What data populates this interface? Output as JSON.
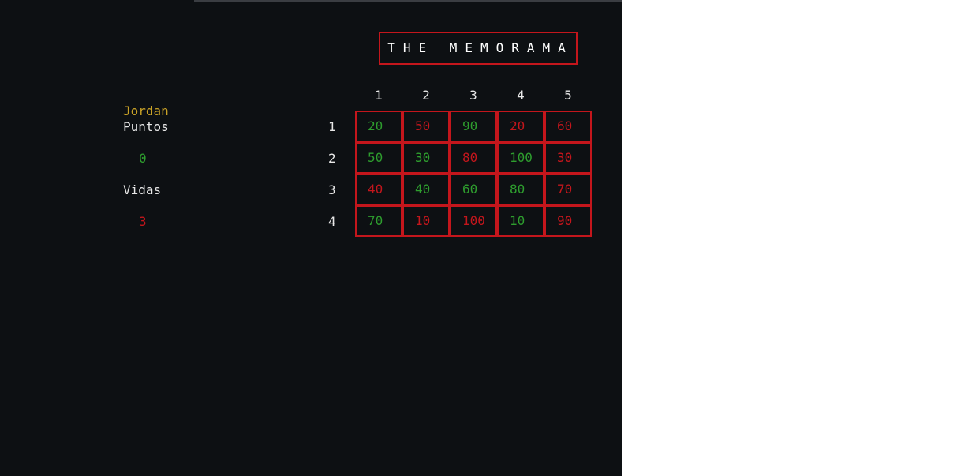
{
  "title": "THE MEMORAMA",
  "player": {
    "name": "Jordan",
    "points_label": "Puntos",
    "points_value": "0",
    "lives_label": "Vidas",
    "lives_value": "3"
  },
  "board": {
    "col_headers": [
      "1",
      "2",
      "3",
      "4",
      "5"
    ],
    "row_headers": [
      "1",
      "2",
      "3",
      "4"
    ],
    "rows": [
      [
        {
          "v": "20",
          "c": "green"
        },
        {
          "v": "50",
          "c": "red"
        },
        {
          "v": "90",
          "c": "green"
        },
        {
          "v": "20",
          "c": "red"
        },
        {
          "v": "60",
          "c": "red"
        }
      ],
      [
        {
          "v": "50",
          "c": "green"
        },
        {
          "v": "30",
          "c": "green"
        },
        {
          "v": "80",
          "c": "red"
        },
        {
          "v": "100",
          "c": "green"
        },
        {
          "v": "30",
          "c": "red"
        }
      ],
      [
        {
          "v": "40",
          "c": "red"
        },
        {
          "v": "40",
          "c": "green"
        },
        {
          "v": "60",
          "c": "green"
        },
        {
          "v": "80",
          "c": "green"
        },
        {
          "v": "70",
          "c": "red"
        }
      ],
      [
        {
          "v": "70",
          "c": "green"
        },
        {
          "v": "10",
          "c": "red"
        },
        {
          "v": "100",
          "c": "red"
        },
        {
          "v": "10",
          "c": "green"
        },
        {
          "v": "90",
          "c": "red"
        }
      ]
    ]
  },
  "colors": {
    "background": "#0d1013",
    "accent_red": "#c4161c",
    "green": "#2e9e2e",
    "player_gold": "#c9a227",
    "text_white": "#e8e8e8"
  }
}
